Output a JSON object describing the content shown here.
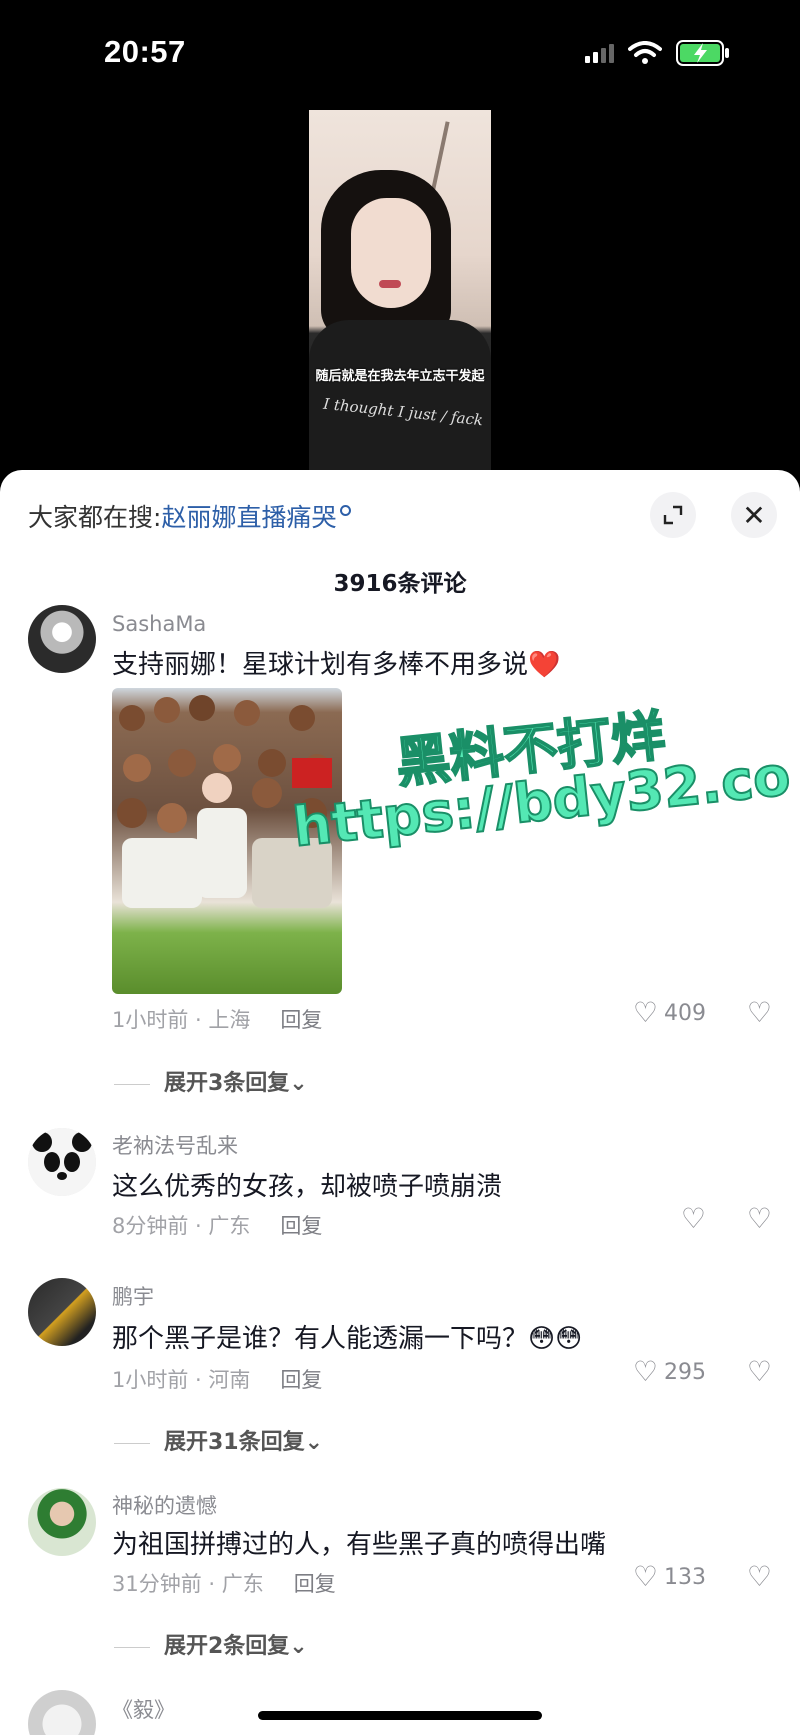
{
  "status_bar": {
    "time": "20:57"
  },
  "video": {
    "caption": "随后就是在我去年立志干发起",
    "shirt_text": "I thought I just / fack"
  },
  "sheet": {
    "search_prefix": "大家都在搜:",
    "search_term": "赵丽娜直播痛哭",
    "comment_count": "3916条评论",
    "close_glyph": "✕",
    "expand_glyph": "⤢"
  },
  "watermark": {
    "line1": "黑料不打烊",
    "line2": "https://bdy32.co"
  },
  "comments": [
    {
      "name": "SashaMa",
      "text": "支持丽娜！星球计划有多棒不用多说❤️",
      "meta": "1小时前 · 上海",
      "reply": "回复",
      "likes": "409",
      "expand": "展开3条回复⌄"
    },
    {
      "name": "老衲法号乱来",
      "text": "这么优秀的女孩，却被喷子喷崩溃",
      "meta": "8分钟前 · 广东",
      "reply": "回复",
      "likes": ""
    },
    {
      "name": "鹏宇",
      "text": "那个黑子是谁？有人能透漏一下吗？😳😳",
      "meta": "1小时前 · 河南",
      "reply": "回复",
      "likes": "295",
      "expand": "展开31条回复⌄"
    },
    {
      "name": "神秘的遗憾",
      "text": "为祖国拼搏过的人，有些黑子真的喷得出嘴",
      "meta": "31分钟前 · 广东",
      "reply": "回复",
      "likes": "133",
      "expand": "展开2条回复⌄"
    },
    {
      "name": "《毅》"
    }
  ],
  "icons": {
    "heart": "♡",
    "dislike": "♡"
  }
}
